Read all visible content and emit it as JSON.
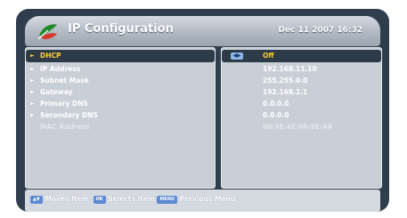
{
  "header": {
    "title": "IP Configuration",
    "datetime": "Dec 11 2007 16:32"
  },
  "fields": [
    {
      "label": "DHCP",
      "value": "Off",
      "selected": true
    },
    {
      "label": "IP Address",
      "value": "192.168.11.10"
    },
    {
      "label": "Subnet Mask",
      "value": "255.255.0.0"
    },
    {
      "label": "Gateway",
      "value": "192.168.1.1"
    },
    {
      "label": "Primary DNS",
      "value": "0.0.0.0"
    },
    {
      "label": "Secondary DNS",
      "value": "0.0.0.0"
    },
    {
      "label": "MAC Address",
      "value": "00:3E:4E:06:5E:AA",
      "disabled": true
    }
  ],
  "footer": {
    "move_key": "▲▼",
    "move_text": "Moves Item",
    "ok_key": "OK",
    "ok_text": "Selects Item",
    "menu_key": "MENU",
    "menu_text": "Previous Menu"
  },
  "icons": {
    "logo": "leaf-logo-icon",
    "left_right": "left-right-arrow-icon"
  },
  "colors": {
    "frame": "#2f3d4d",
    "panel": "#c9cfd6",
    "highlight_text": "#ffd23a",
    "key": "#5b89d6"
  }
}
